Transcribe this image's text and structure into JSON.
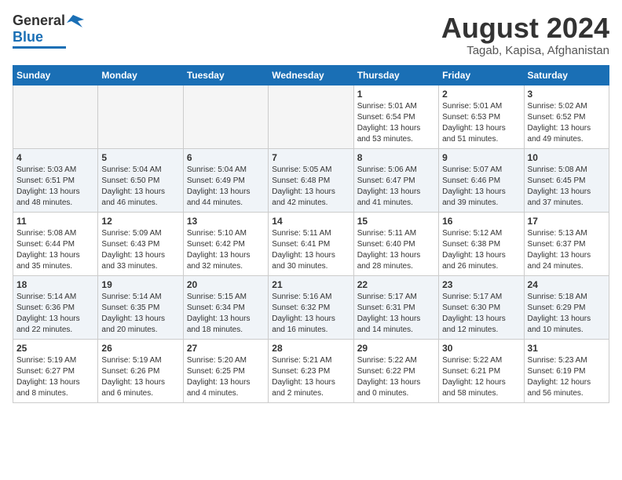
{
  "header": {
    "logo_general": "General",
    "logo_blue": "Blue",
    "month_title": "August 2024",
    "location": "Tagab, Kapisa, Afghanistan"
  },
  "weekdays": [
    "Sunday",
    "Monday",
    "Tuesday",
    "Wednesday",
    "Thursday",
    "Friday",
    "Saturday"
  ],
  "weeks": [
    {
      "row_class": "row-odd",
      "days": [
        {
          "num": "",
          "detail": "",
          "empty": true
        },
        {
          "num": "",
          "detail": "",
          "empty": true
        },
        {
          "num": "",
          "detail": "",
          "empty": true
        },
        {
          "num": "",
          "detail": "",
          "empty": true
        },
        {
          "num": "1",
          "detail": "Sunrise: 5:01 AM\nSunset: 6:54 PM\nDaylight: 13 hours\nand 53 minutes."
        },
        {
          "num": "2",
          "detail": "Sunrise: 5:01 AM\nSunset: 6:53 PM\nDaylight: 13 hours\nand 51 minutes."
        },
        {
          "num": "3",
          "detail": "Sunrise: 5:02 AM\nSunset: 6:52 PM\nDaylight: 13 hours\nand 49 minutes."
        }
      ]
    },
    {
      "row_class": "row-even",
      "days": [
        {
          "num": "4",
          "detail": "Sunrise: 5:03 AM\nSunset: 6:51 PM\nDaylight: 13 hours\nand 48 minutes."
        },
        {
          "num": "5",
          "detail": "Sunrise: 5:04 AM\nSunset: 6:50 PM\nDaylight: 13 hours\nand 46 minutes."
        },
        {
          "num": "6",
          "detail": "Sunrise: 5:04 AM\nSunset: 6:49 PM\nDaylight: 13 hours\nand 44 minutes."
        },
        {
          "num": "7",
          "detail": "Sunrise: 5:05 AM\nSunset: 6:48 PM\nDaylight: 13 hours\nand 42 minutes."
        },
        {
          "num": "8",
          "detail": "Sunrise: 5:06 AM\nSunset: 6:47 PM\nDaylight: 13 hours\nand 41 minutes."
        },
        {
          "num": "9",
          "detail": "Sunrise: 5:07 AM\nSunset: 6:46 PM\nDaylight: 13 hours\nand 39 minutes."
        },
        {
          "num": "10",
          "detail": "Sunrise: 5:08 AM\nSunset: 6:45 PM\nDaylight: 13 hours\nand 37 minutes."
        }
      ]
    },
    {
      "row_class": "row-odd",
      "days": [
        {
          "num": "11",
          "detail": "Sunrise: 5:08 AM\nSunset: 6:44 PM\nDaylight: 13 hours\nand 35 minutes."
        },
        {
          "num": "12",
          "detail": "Sunrise: 5:09 AM\nSunset: 6:43 PM\nDaylight: 13 hours\nand 33 minutes."
        },
        {
          "num": "13",
          "detail": "Sunrise: 5:10 AM\nSunset: 6:42 PM\nDaylight: 13 hours\nand 32 minutes."
        },
        {
          "num": "14",
          "detail": "Sunrise: 5:11 AM\nSunset: 6:41 PM\nDaylight: 13 hours\nand 30 minutes."
        },
        {
          "num": "15",
          "detail": "Sunrise: 5:11 AM\nSunset: 6:40 PM\nDaylight: 13 hours\nand 28 minutes."
        },
        {
          "num": "16",
          "detail": "Sunrise: 5:12 AM\nSunset: 6:38 PM\nDaylight: 13 hours\nand 26 minutes."
        },
        {
          "num": "17",
          "detail": "Sunrise: 5:13 AM\nSunset: 6:37 PM\nDaylight: 13 hours\nand 24 minutes."
        }
      ]
    },
    {
      "row_class": "row-even",
      "days": [
        {
          "num": "18",
          "detail": "Sunrise: 5:14 AM\nSunset: 6:36 PM\nDaylight: 13 hours\nand 22 minutes."
        },
        {
          "num": "19",
          "detail": "Sunrise: 5:14 AM\nSunset: 6:35 PM\nDaylight: 13 hours\nand 20 minutes."
        },
        {
          "num": "20",
          "detail": "Sunrise: 5:15 AM\nSunset: 6:34 PM\nDaylight: 13 hours\nand 18 minutes."
        },
        {
          "num": "21",
          "detail": "Sunrise: 5:16 AM\nSunset: 6:32 PM\nDaylight: 13 hours\nand 16 minutes."
        },
        {
          "num": "22",
          "detail": "Sunrise: 5:17 AM\nSunset: 6:31 PM\nDaylight: 13 hours\nand 14 minutes."
        },
        {
          "num": "23",
          "detail": "Sunrise: 5:17 AM\nSunset: 6:30 PM\nDaylight: 13 hours\nand 12 minutes."
        },
        {
          "num": "24",
          "detail": "Sunrise: 5:18 AM\nSunset: 6:29 PM\nDaylight: 13 hours\nand 10 minutes."
        }
      ]
    },
    {
      "row_class": "row-odd",
      "days": [
        {
          "num": "25",
          "detail": "Sunrise: 5:19 AM\nSunset: 6:27 PM\nDaylight: 13 hours\nand 8 minutes."
        },
        {
          "num": "26",
          "detail": "Sunrise: 5:19 AM\nSunset: 6:26 PM\nDaylight: 13 hours\nand 6 minutes."
        },
        {
          "num": "27",
          "detail": "Sunrise: 5:20 AM\nSunset: 6:25 PM\nDaylight: 13 hours\nand 4 minutes."
        },
        {
          "num": "28",
          "detail": "Sunrise: 5:21 AM\nSunset: 6:23 PM\nDaylight: 13 hours\nand 2 minutes."
        },
        {
          "num": "29",
          "detail": "Sunrise: 5:22 AM\nSunset: 6:22 PM\nDaylight: 13 hours\nand 0 minutes."
        },
        {
          "num": "30",
          "detail": "Sunrise: 5:22 AM\nSunset: 6:21 PM\nDaylight: 12 hours\nand 58 minutes."
        },
        {
          "num": "31",
          "detail": "Sunrise: 5:23 AM\nSunset: 6:19 PM\nDaylight: 12 hours\nand 56 minutes."
        }
      ]
    }
  ]
}
